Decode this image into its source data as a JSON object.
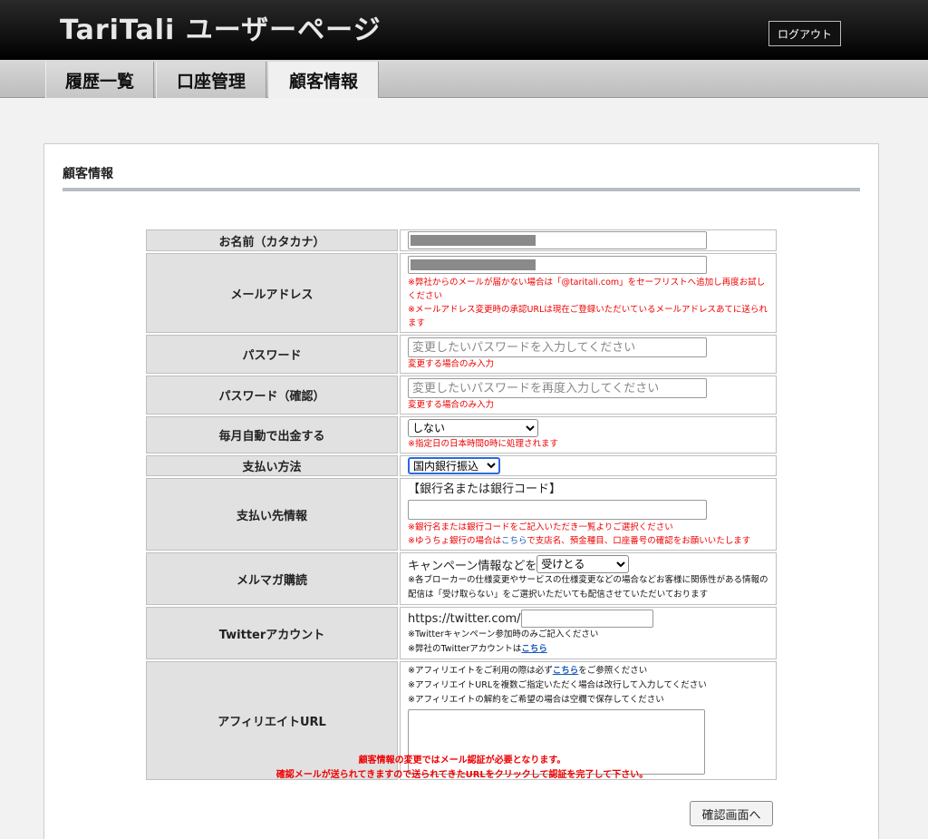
{
  "header": {
    "title": "TariTali ユーザーページ",
    "logout_label": "ログアウト"
  },
  "nav": {
    "tabs": [
      {
        "label": "履歴一覧"
      },
      {
        "label": "口座管理"
      },
      {
        "label": "顧客情報",
        "active": true
      }
    ]
  },
  "section": {
    "title": "顧客情報"
  },
  "form": {
    "name": {
      "label": "お名前（カタカナ）"
    },
    "email": {
      "label": "メールアドレス",
      "note1": "※弊社からのメールが届かない場合は「@taritali.com」をセーフリストへ追加し再度お試しください",
      "note2": "※メールアドレス変更時の承認URLは現在ご登録いただいているメールアドレスあてに送られます"
    },
    "password": {
      "label": "パスワード",
      "placeholder": "変更したいパスワードを入力してください",
      "note": "変更する場合のみ入力"
    },
    "password_confirm": {
      "label": "パスワード（確認）",
      "placeholder": "変更したいパスワードを再度入力してください",
      "note": "変更する場合のみ入力"
    },
    "auto_withdraw": {
      "label": "毎月自動で出金する",
      "value": "しない",
      "note": "※指定日の日本時間0時に処理されます"
    },
    "payment_method": {
      "label": "支払い方法",
      "value": "国内銀行振込"
    },
    "payment_info": {
      "label": "支払い先情報",
      "bank_label": "【銀行名または銀行コード】",
      "note1": "※銀行名または銀行コードをご記入いただき一覧よりご選択ください",
      "note2_pre": "※ゆうちょ銀行の場合は",
      "note2_link": "こちら",
      "note2_post": "で支店名、預金種目、口座番号の確認をお願いいたします"
    },
    "newsletter": {
      "label": "メルマガ購読",
      "prefix": "キャンペーン情報などを",
      "value": "受けとる",
      "note": "※各ブローカーの仕様変更やサービスの仕様変更などの場合などお客様に関係性がある情報の配信は「受け取らない」をご選択いただいても配信させていただいております"
    },
    "twitter": {
      "label": "Twitterアカウント",
      "prefix": "https://twitter.com/",
      "note1": "※Twitterキャンペーン参加時のみご記入ください",
      "note2_pre": "※弊社のTwitterアカウントは",
      "note2_link": "こちら"
    },
    "affiliate": {
      "label": "アフィリエイトURL",
      "note1_pre": "※アフィリエイトをご利用の際は必ず",
      "note1_link": "こちら",
      "note1_post": "をご参照ください",
      "note2": "※アフィリエイトURLを複数ご指定いただく場合は改行して入力してください",
      "note3": "※アフィリエイトの解約をご希望の場合は空欄で保存してください"
    }
  },
  "warning": {
    "line1": "顧客情報の変更ではメール認証が必要となります。",
    "line2": "確認メールが送られてきますので送られてきたURLをクリックして認証を完了して下さい。"
  },
  "confirm_label": "確認画面へ"
}
